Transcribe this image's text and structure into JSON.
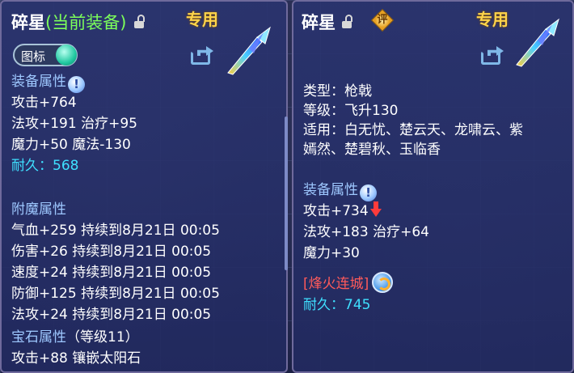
{
  "left": {
    "title": "碎星",
    "title_tag": "(当前装备)",
    "exclusive": "专用",
    "toggle_label": "图标",
    "equip_header": "装备属性",
    "stats": [
      "攻击+764",
      "法攻+191 治疗+95",
      "魔力+50 魔法-130"
    ],
    "durability": "耐久：568",
    "enchant_header": "附魔属性",
    "enchants": [
      "气血+259 持续到8月21日 00:05",
      "伤害+26 持续到8月21日 00:05",
      "速度+24 持续到8月21日 00:05",
      "防御+125 持续到8月21日 00:05",
      "法攻+24 持续到8月21日 00:05"
    ],
    "gem_header": "宝石属性",
    "gem_level": "（等级11）",
    "gem_line": "攻击+88 镶嵌太阳石"
  },
  "right": {
    "title": "碎星",
    "rating_label": "评",
    "exclusive": "专用",
    "type_line": "类型：枪戟",
    "level_line": "等级：飞升130",
    "suitable_line1": "适用：白无忧、楚云天、龙啸云、紫",
    "suitable_line2": "嫣然、楚碧秋、玉临香",
    "equip_header": "装备属性",
    "stats": [
      "攻击+734",
      "法攻+183 治疗+64",
      "魔力+30"
    ],
    "special": "[烽火连城]",
    "durability": "耐久：745"
  },
  "icons": {
    "lock": "lock-icon",
    "share": "share-icon",
    "weapon": "spear-weapon-icon",
    "info": "info-icon",
    "down": "down-arrow-icon",
    "refresh": "refresh-icon"
  },
  "colors": {
    "equip_tag": "#7cff5a",
    "exclusive": "#ffd44a",
    "header": "#9ec8ff",
    "durability": "#3fe0ff",
    "special": "#ff5a5a"
  }
}
